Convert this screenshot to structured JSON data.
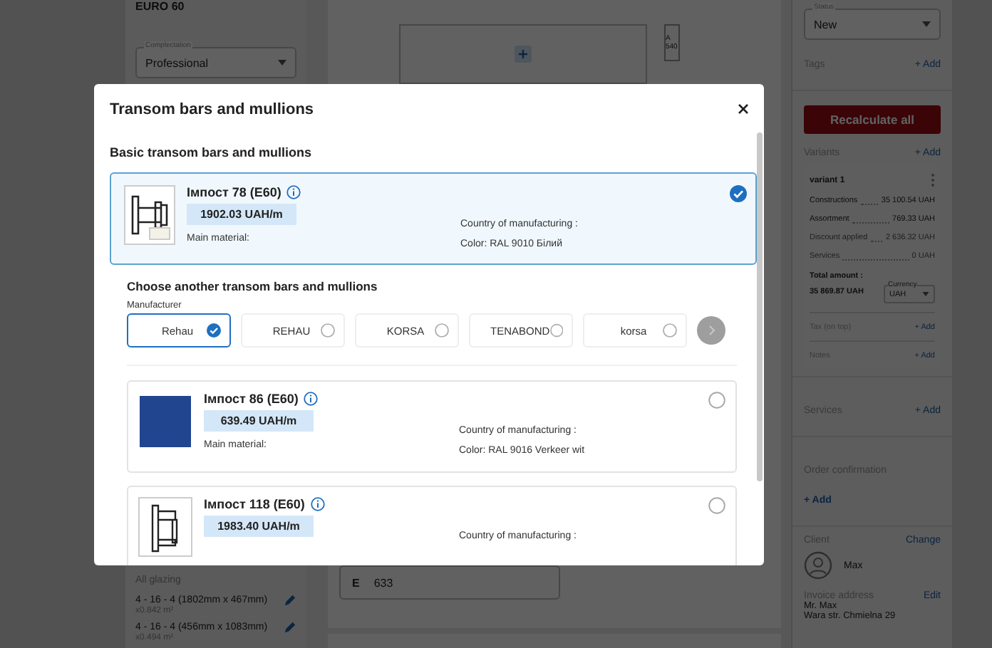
{
  "left_panel": {
    "series_title": "EURO 60",
    "complectation": {
      "label": "Complectation",
      "value": "Professional"
    },
    "glazing": {
      "title": "All glazing",
      "items": [
        {
          "size": "4 - 16 - 4 (1802mm x 467mm)",
          "area": "x0.842 m²"
        },
        {
          "size": "4 - 16 - 4 (456mm x 1083mm)",
          "area": "x0.494 m²"
        }
      ]
    }
  },
  "canvas": {
    "dimension_label": "A 540",
    "field": {
      "letter": "E",
      "value": "633"
    }
  },
  "right_panel": {
    "status": {
      "label": "Status",
      "value": "New"
    },
    "tags": {
      "title": "Tags",
      "action": "+ Add"
    },
    "recalculate_button": "Recalculate all",
    "variants": {
      "title": "Variants",
      "action": "+ Add",
      "card": {
        "name": "variant 1",
        "rows": [
          {
            "label": "Constructions",
            "value": "35 100.54 UAH",
            "muted": false
          },
          {
            "label": "Assortment",
            "value": "769.33 UAH",
            "muted": false
          },
          {
            "label": "Discount applied",
            "value": "2 636.32 UAH",
            "muted": true
          },
          {
            "label": "Services",
            "value": "0 UAH",
            "muted": true
          }
        ],
        "total_label": "Total amount :",
        "total_value": "35 869.87 UAH",
        "currency": {
          "label": "Currency",
          "value": "UAH"
        },
        "extras": [
          {
            "label": "Tax (on top)",
            "action": "+ Add"
          },
          {
            "label": "Notes",
            "action": "+ Add"
          }
        ]
      }
    },
    "services": {
      "title": "Services",
      "action": "+ Add"
    },
    "order_confirmation": {
      "title": "Order confirmation",
      "action": "+ Add"
    },
    "client": {
      "title": "Client",
      "action": "Change",
      "name": "Max"
    },
    "invoice_address": {
      "title": "Invoice address",
      "action": "Edit",
      "lines": [
        "Mr. Max",
        "Wara str. Chmielna 29"
      ]
    }
  },
  "dialog": {
    "title": "Transom bars and mullions",
    "basic_section_title": "Basic transom bars and mullions",
    "basic_item": {
      "name": "Імпост 78 (E60)",
      "price": "1902.03 UAH/m",
      "material": "Main material:",
      "country": "Country of manufacturing :",
      "finish": "Color: RAL 9010 Білий",
      "kind": "drawing",
      "selected": true
    },
    "choose_section_title": "Choose another transom bars and mullions",
    "manufacturer_label": "Manufacturer",
    "manufacturers": [
      {
        "name": "Rehau",
        "selected": true
      },
      {
        "name": "REHAU",
        "selected": false
      },
      {
        "name": "KORSA",
        "selected": false
      },
      {
        "name": "TENABOND",
        "selected": false
      },
      {
        "name": "korsa",
        "selected": false
      }
    ],
    "items": [
      {
        "name": "Імпост 86 (E60)",
        "price": "639.49 UAH/m",
        "material": "Main material:",
        "country": "Country of manufacturing :",
        "finish": "Color: RAL 9016 Verkeer wit",
        "kind": "photo",
        "selected": false
      },
      {
        "name": "Імпост 118 (E60)",
        "price": "1983.40 UAH/m",
        "country": "Country of manufacturing :",
        "kind": "drawing",
        "selected": false
      }
    ]
  }
}
